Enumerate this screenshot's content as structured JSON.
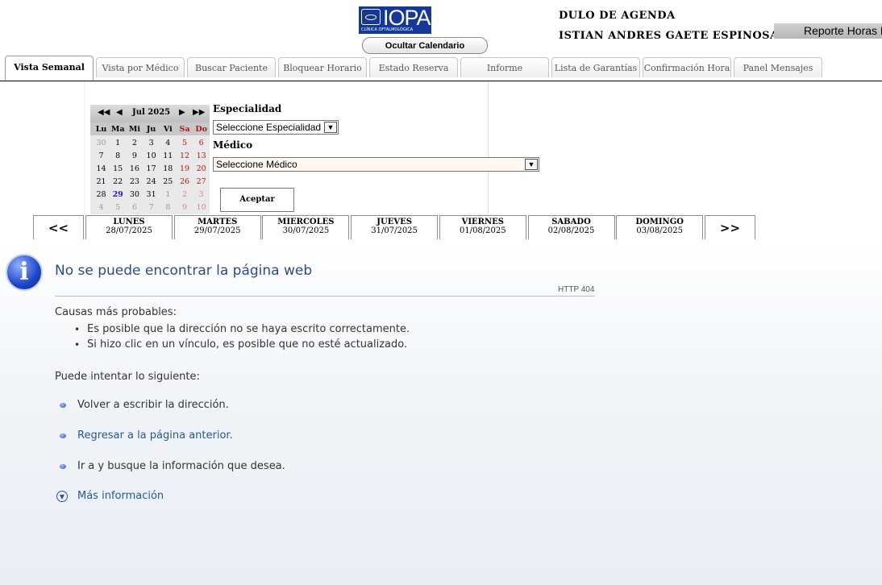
{
  "header": {
    "logo_name": "IOPA",
    "logo_sub": "CLÍNICA OFTALMOLÓGICA",
    "hide_calendar": "Ocultar Calendario",
    "module": "DULO DE AGENDA",
    "user": "ISTIAN ANDRES GAETE ESPINOSA",
    "report": "Reporte Horas D"
  },
  "tabs": [
    "Vista Semanal",
    "Vista por Médico",
    "Buscar Paciente",
    "Bloquear Horario",
    "Estado Reserva",
    "Informe",
    "Lista de Garantías",
    "Confirmación Hora",
    "Panel Mensajes"
  ],
  "calendar": {
    "month_label": "Jul 2025",
    "nav": {
      "prev_year": "◀◀",
      "prev": "◀",
      "next": "▶",
      "next_year": "▶▶"
    },
    "weekdays": [
      "Lu",
      "Ma",
      "Mi",
      "Ju",
      "Vi",
      "Sa",
      "Do"
    ],
    "weeks": [
      [
        "30",
        "1",
        "2",
        "3",
        "4",
        "5",
        "6"
      ],
      [
        "7",
        "8",
        "9",
        "10",
        "11",
        "12",
        "13"
      ],
      [
        "14",
        "15",
        "16",
        "17",
        "18",
        "19",
        "20"
      ],
      [
        "21",
        "22",
        "23",
        "24",
        "25",
        "26",
        "27"
      ],
      [
        "28",
        "29",
        "30",
        "31",
        "1",
        "2",
        "3"
      ],
      [
        "4",
        "5",
        "6",
        "7",
        "8",
        "9",
        "10"
      ]
    ],
    "today": "29"
  },
  "form": {
    "especialidad_label": "Especialidad",
    "especialidad_value": "Seleccione Especialidad",
    "medico_label": "Médico",
    "medico_value": "Seleccione Médico",
    "accept": "Aceptar"
  },
  "week": {
    "prev": "<<",
    "next": ">>",
    "days": [
      {
        "name": "LUNES",
        "date": "28/07/2025"
      },
      {
        "name": "MARTES",
        "date": "29/07/2025"
      },
      {
        "name": "MIERCOLES",
        "date": "30/07/2025"
      },
      {
        "name": "JUEVES",
        "date": "31/07/2025"
      },
      {
        "name": "VIERNES",
        "date": "01/08/2025"
      },
      {
        "name": "SABADO",
        "date": "02/08/2025"
      },
      {
        "name": "DOMINGO",
        "date": "03/08/2025"
      }
    ]
  },
  "error": {
    "title": "No se puede encontrar la página web",
    "code": "HTTP 404",
    "causes_title": "Causas más probables:",
    "causes": [
      "Es posible que la dirección no se haya escrito correctamente.",
      "Si hizo clic en un vínculo, es posible que no esté actualizado."
    ],
    "try_title": "Puede intentar lo siguiente:",
    "actions": [
      "Volver a escribir la dirección.",
      "Regresar a la página anterior.",
      "Ir a  y busque la información que desea."
    ],
    "more": "Más información"
  }
}
